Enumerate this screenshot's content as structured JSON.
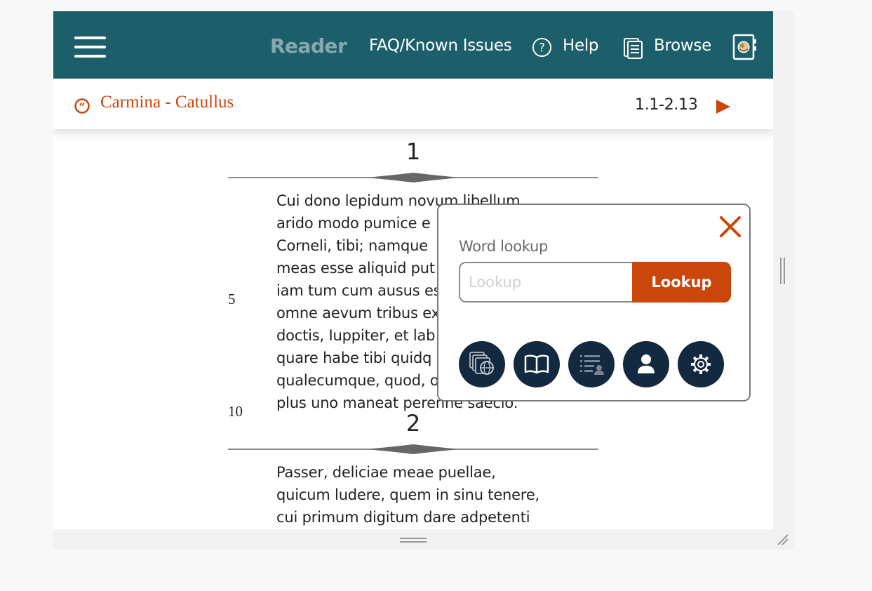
{
  "nav": {
    "brand": "Reader",
    "faq_label": "FAQ/Known Issues",
    "help_label": "Help",
    "browse_label": "Browse",
    "bg_color": "#1c5f6b",
    "icons": [
      "hamburger-menu-icon",
      "help-circle-icon",
      "browse-book-icon",
      "profile-card-icon"
    ]
  },
  "textbar": {
    "title": "Carmina - Catullus",
    "range": "1.1-2.13",
    "accent_color": "#c9470a",
    "icons": [
      "quote-icon",
      "next-arrow-icon"
    ]
  },
  "reading": {
    "poems": [
      {
        "number": "1",
        "lines": [
          "Cui dono lepidum novum libellum",
          "arido modo pumice e",
          "Corneli, tibi; namque",
          "meas esse aliquid put",
          "iam tum cum ausus es",
          "omne aevum tribus ex",
          "doctis, Iuppiter, et lab",
          "quare habe tibi quidq",
          "qualecumque, quod, o",
          "plus uno maneat perenne saeclo."
        ],
        "line_numbers": [
          "5",
          "10"
        ]
      },
      {
        "number": "2",
        "lines": [
          "Passer, deliciae meae puellae,",
          "quicum ludere, quem in sinu tenere,",
          "cui primum digitum dare adpetenti"
        ]
      }
    ]
  },
  "lookup_popup": {
    "label": "Word lookup",
    "input_value": "",
    "input_placeholder": "Lookup",
    "button_label": "Lookup",
    "button_color": "#c9470a",
    "tool_color": "#12293f",
    "tools": [
      "parallel-texts-icon",
      "dictionary-book-icon",
      "word-list-icon",
      "user-profile-icon",
      "settings-gear-icon"
    ]
  }
}
